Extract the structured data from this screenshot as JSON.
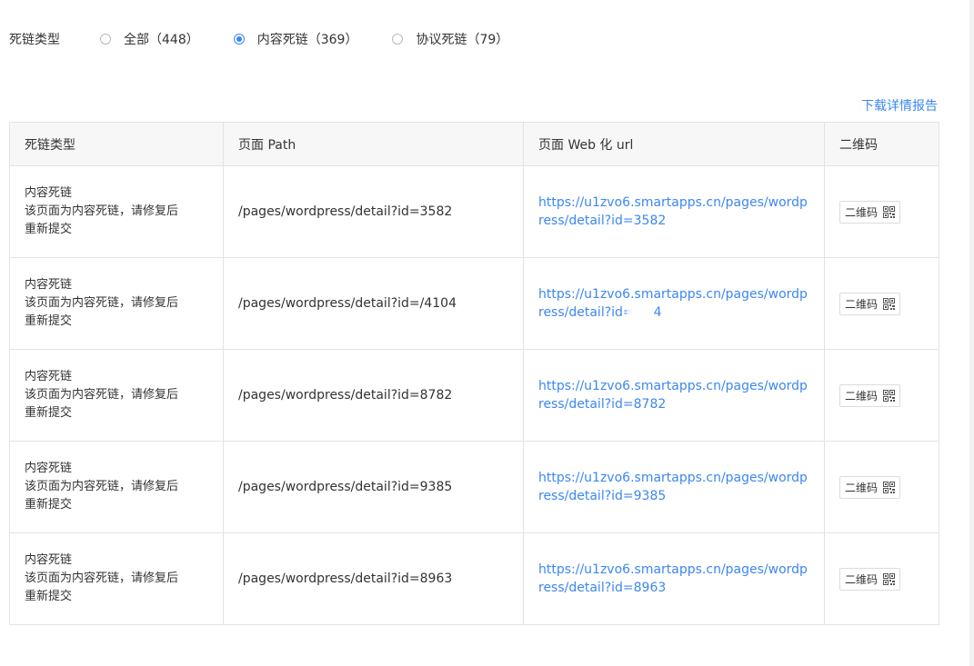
{
  "filter": {
    "label": "死链类型",
    "options": [
      {
        "label": "全部（448）",
        "checked": false
      },
      {
        "label": "内容死链（369）",
        "checked": true
      },
      {
        "label": "协议死链（79）",
        "checked": false
      }
    ]
  },
  "download_label": "下载详情报告",
  "table": {
    "headers": [
      "死链类型",
      "页面 Path",
      "页面 Web 化 url",
      "二维码"
    ],
    "rows": [
      {
        "type_title": "内容死链",
        "type_desc_1": "该页面为内容死链，请修复后",
        "type_desc_2": "重新提交",
        "path": "/pages/wordpress/detail?id=3582",
        "url": "https://u1zvo6.smartapps.cn/pages/wordpress/detail?id=3582",
        "qr_label": "二维码"
      },
      {
        "type_title": "内容死链",
        "type_desc_1": "该页面为内容死链，请修复后",
        "type_desc_2": "重新提交",
        "path": "/pages/wordpress/detail?id=/4104",
        "url_prefix": "https://u1zvo6.smartapps.cn/pages/wordpress/detail?id=",
        "url_suffix": "4",
        "qr_label": "二维码"
      },
      {
        "type_title": "内容死链",
        "type_desc_1": "该页面为内容死链，请修复后",
        "type_desc_2": "重新提交",
        "path": "/pages/wordpress/detail?id=8782",
        "url": "https://u1zvo6.smartapps.cn/pages/wordpress/detail?id=8782",
        "qr_label": "二维码"
      },
      {
        "type_title": "内容死链",
        "type_desc_1": "该页面为内容死链，请修复后",
        "type_desc_2": "重新提交",
        "path": "/pages/wordpress/detail?id=9385",
        "url": "https://u1zvo6.smartapps.cn/pages/wordpress/detail?id=9385",
        "qr_label": "二维码"
      },
      {
        "type_title": "内容死链",
        "type_desc_1": "该页面为内容死链，请修复后",
        "type_desc_2": "重新提交",
        "path": "/pages/wordpress/detail?id=8963",
        "url": "https://u1zvo6.smartapps.cn/pages/wordpress/detail?id=8963",
        "qr_label": "二维码"
      }
    ]
  },
  "colors": {
    "link": "#3c87f0",
    "text": "#333333",
    "header_bg": "#f7f7f7",
    "border": "#e3e3e3"
  },
  "icons": {
    "radio": "radio-icon",
    "qr": "qr-code-icon"
  }
}
